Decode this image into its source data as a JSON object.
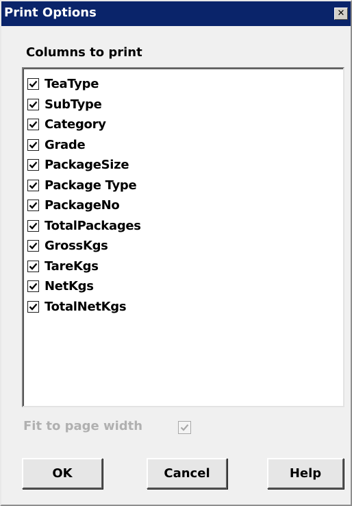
{
  "window": {
    "title": "Print Options",
    "close_glyph": "✕"
  },
  "columns_section": {
    "label": "Columns to print",
    "items": [
      {
        "label": "TeaType",
        "checked": true
      },
      {
        "label": "SubType",
        "checked": true
      },
      {
        "label": "Category",
        "checked": true
      },
      {
        "label": "Grade",
        "checked": true
      },
      {
        "label": "PackageSize",
        "checked": true
      },
      {
        "label": "Package Type",
        "checked": true
      },
      {
        "label": "PackageNo",
        "checked": true
      },
      {
        "label": "TotalPackages",
        "checked": true
      },
      {
        "label": "GrossKgs",
        "checked": true
      },
      {
        "label": "TareKgs",
        "checked": true
      },
      {
        "label": "NetKgs",
        "checked": true
      },
      {
        "label": "TotalNetKgs",
        "checked": true
      }
    ]
  },
  "fit_to_page": {
    "label": "Fit to page width",
    "checked": true,
    "enabled": false
  },
  "buttons": {
    "ok": "OK",
    "cancel": "Cancel",
    "help": "Help"
  },
  "colors": {
    "titlebar": "#0a246a",
    "dialog_bg": "#f0f0f0",
    "disabled_text": "#b0b0b0"
  },
  "icons": {
    "close": "close-icon",
    "check": "checkmark-icon"
  }
}
